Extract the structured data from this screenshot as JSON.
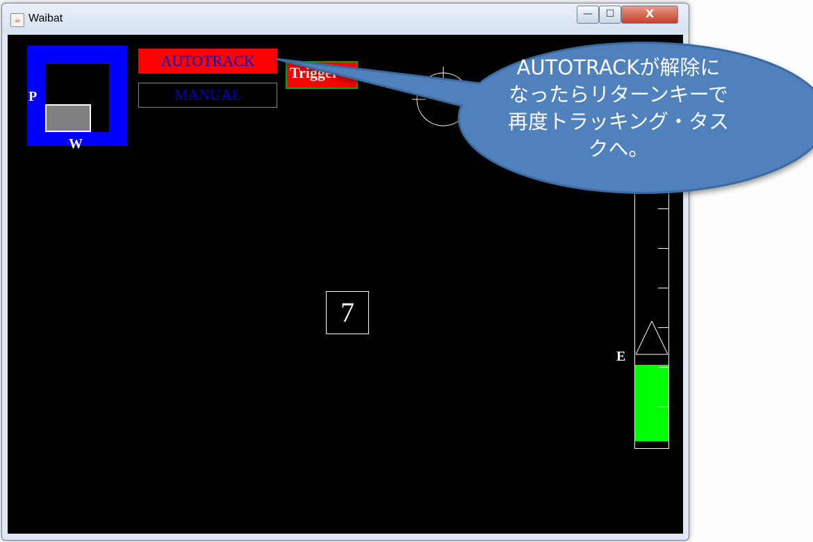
{
  "window": {
    "title": "Waibat",
    "controls": {
      "minimize": "—",
      "maximize": "☐",
      "close": "X"
    }
  },
  "panel": {
    "pw_label_p": "P",
    "pw_label_w": "W",
    "autotrack_label": "AUTOTRACK",
    "manual_label": "MANUAL",
    "trigger_label": "Trigger",
    "center_number": "7",
    "gauge_label": "E"
  },
  "callout": {
    "lines": [
      "AUTOTRACKが解除に",
      "なったらリターンキーで",
      "再度トラッキング・タス",
      "クへ。"
    ]
  },
  "colors": {
    "autotrack_bg": "#ff0000",
    "autotrack_text": "#0000cc",
    "pw_box": "#0000ff",
    "gauge_fill": "#00ff00",
    "callout_fill": "#4f81bd"
  }
}
